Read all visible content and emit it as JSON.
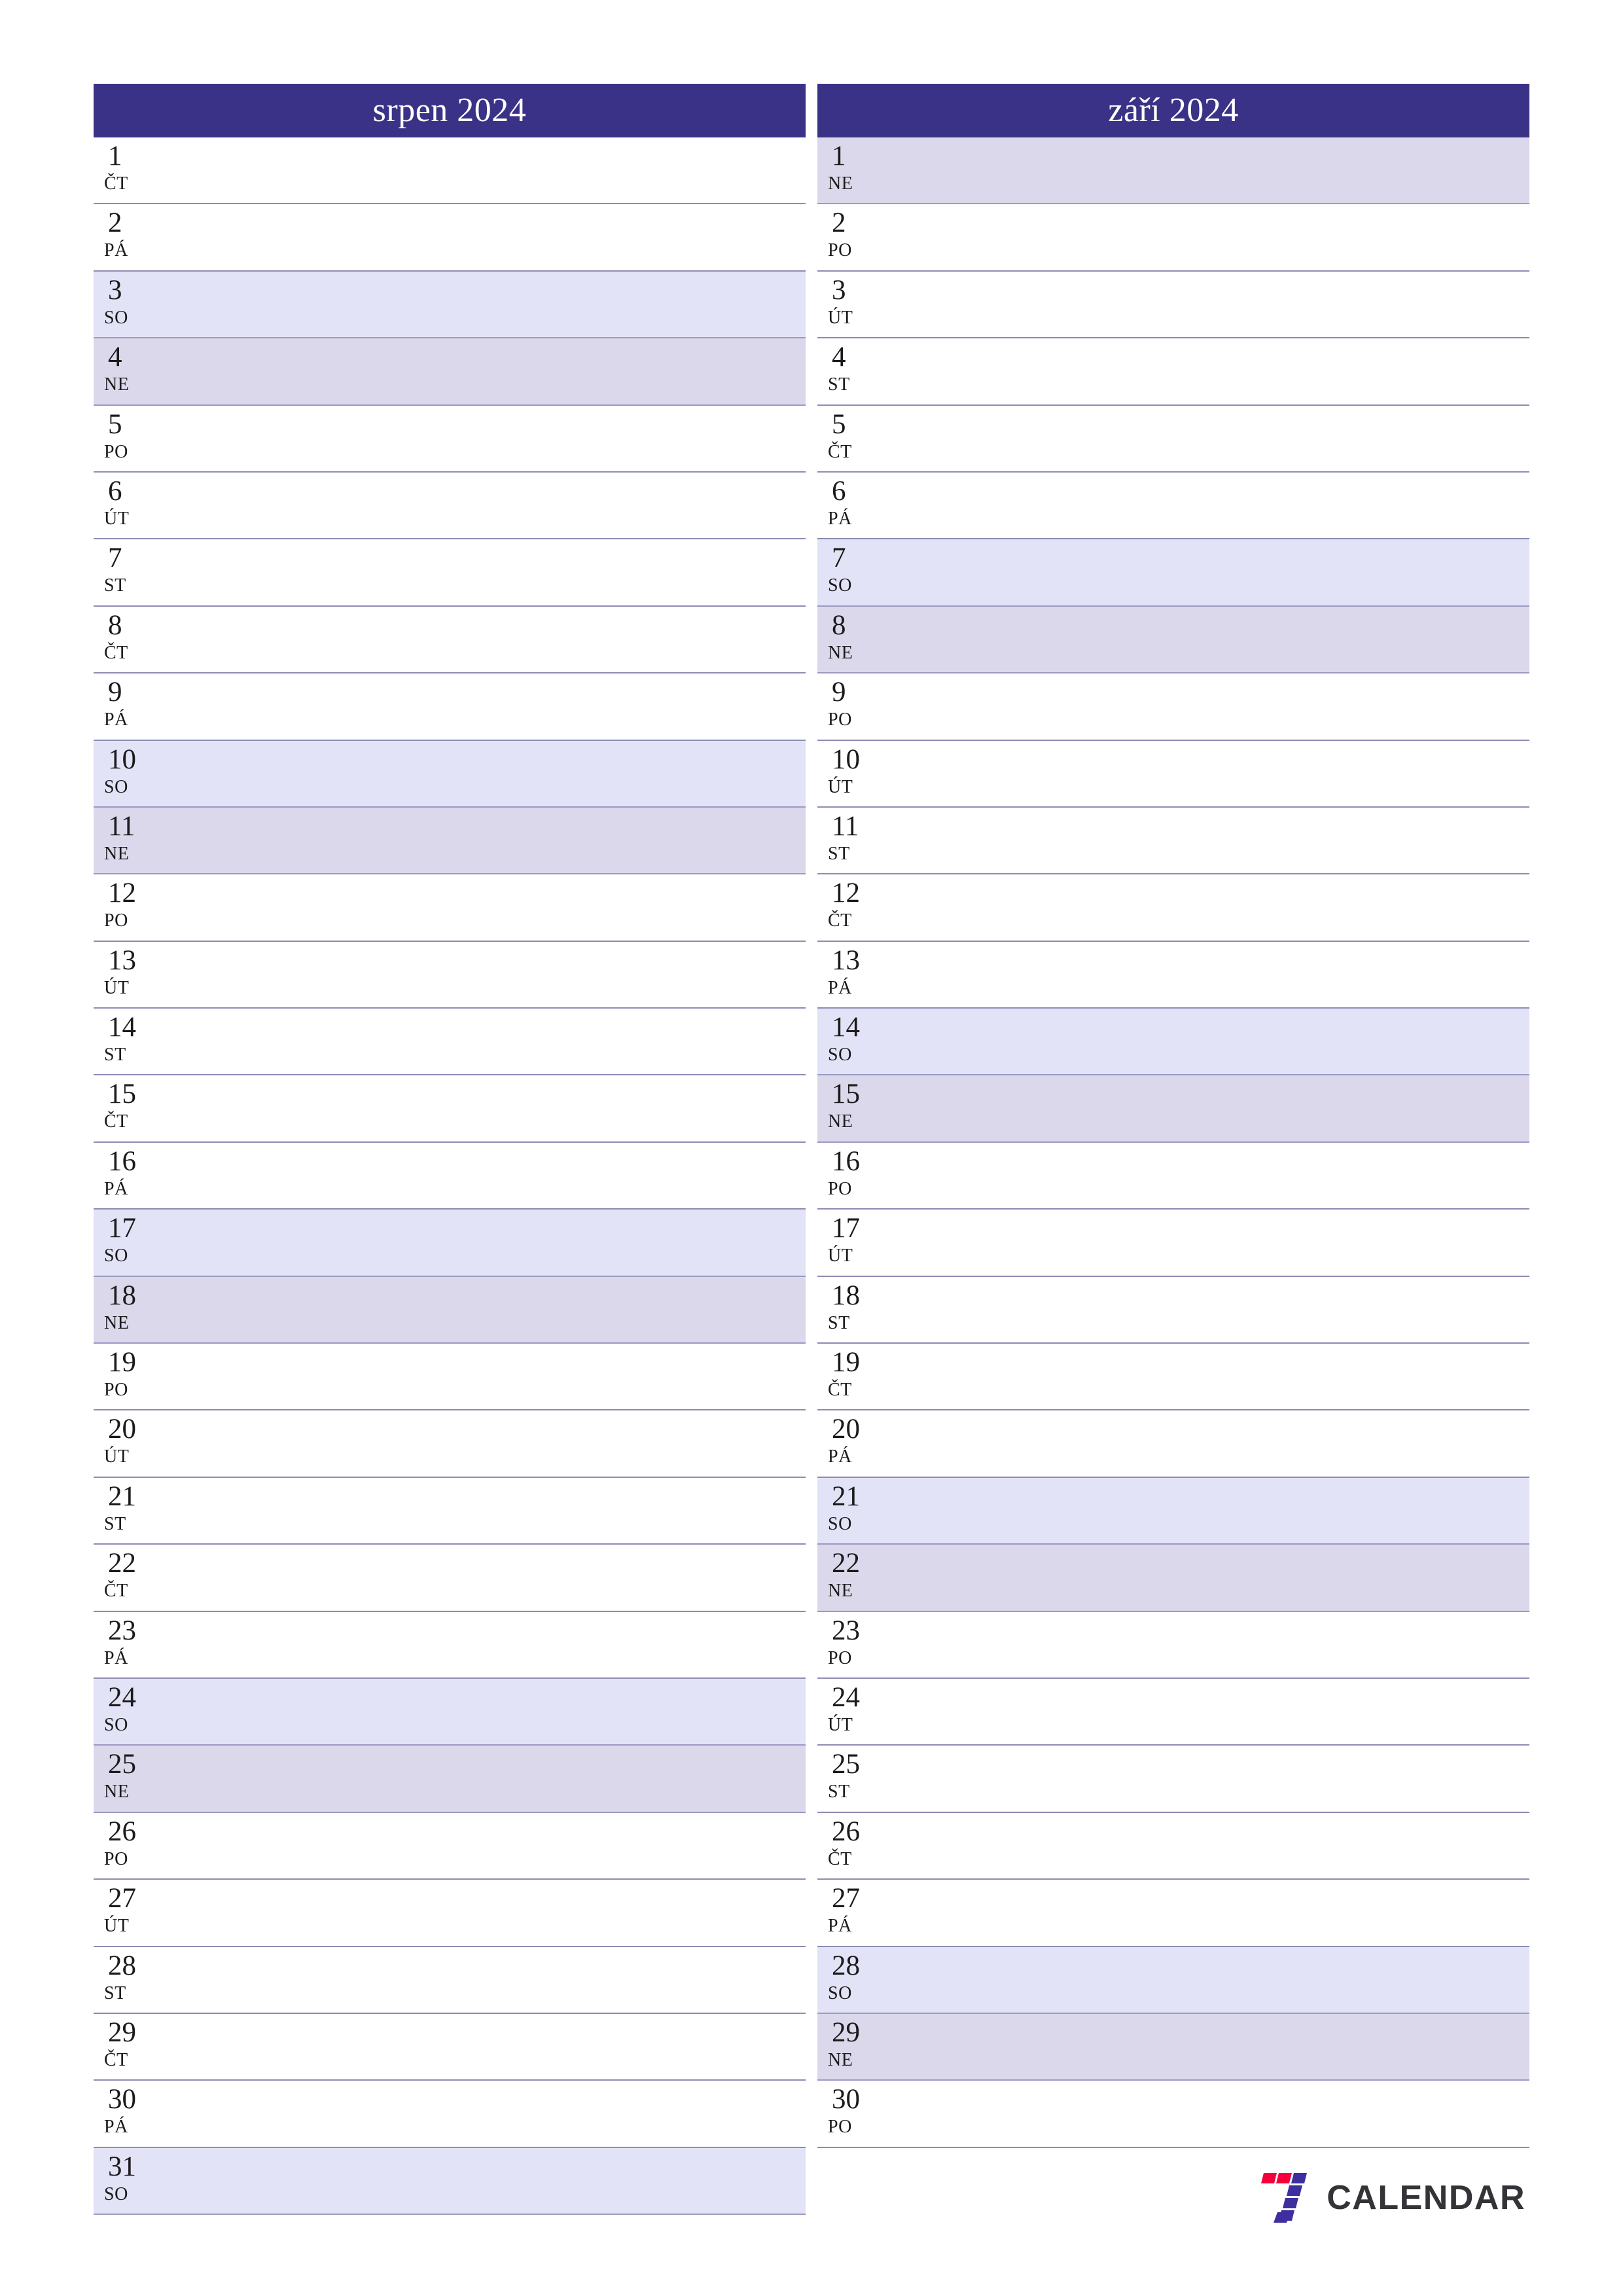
{
  "colors": {
    "header_bg": "#3a3287",
    "saturday_bg": "#e3e3f7",
    "sunday_bg": "#dcd8ec",
    "rule": "#8c8cb4",
    "logo_red": "#f5003c",
    "logo_purple": "#3d2f9e",
    "logo_text": "#333338"
  },
  "months": [
    {
      "title": "srpen 2024",
      "days": [
        {
          "num": "1",
          "dow": "ČT",
          "type": "weekday"
        },
        {
          "num": "2",
          "dow": "PÁ",
          "type": "weekday"
        },
        {
          "num": "3",
          "dow": "SO",
          "type": "sat"
        },
        {
          "num": "4",
          "dow": "NE",
          "type": "sun"
        },
        {
          "num": "5",
          "dow": "PO",
          "type": "weekday"
        },
        {
          "num": "6",
          "dow": "ÚT",
          "type": "weekday"
        },
        {
          "num": "7",
          "dow": "ST",
          "type": "weekday"
        },
        {
          "num": "8",
          "dow": "ČT",
          "type": "weekday"
        },
        {
          "num": "9",
          "dow": "PÁ",
          "type": "weekday"
        },
        {
          "num": "10",
          "dow": "SO",
          "type": "sat"
        },
        {
          "num": "11",
          "dow": "NE",
          "type": "sun"
        },
        {
          "num": "12",
          "dow": "PO",
          "type": "weekday"
        },
        {
          "num": "13",
          "dow": "ÚT",
          "type": "weekday"
        },
        {
          "num": "14",
          "dow": "ST",
          "type": "weekday"
        },
        {
          "num": "15",
          "dow": "ČT",
          "type": "weekday"
        },
        {
          "num": "16",
          "dow": "PÁ",
          "type": "weekday"
        },
        {
          "num": "17",
          "dow": "SO",
          "type": "sat"
        },
        {
          "num": "18",
          "dow": "NE",
          "type": "sun"
        },
        {
          "num": "19",
          "dow": "PO",
          "type": "weekday"
        },
        {
          "num": "20",
          "dow": "ÚT",
          "type": "weekday"
        },
        {
          "num": "21",
          "dow": "ST",
          "type": "weekday"
        },
        {
          "num": "22",
          "dow": "ČT",
          "type": "weekday"
        },
        {
          "num": "23",
          "dow": "PÁ",
          "type": "weekday"
        },
        {
          "num": "24",
          "dow": "SO",
          "type": "sat"
        },
        {
          "num": "25",
          "dow": "NE",
          "type": "sun"
        },
        {
          "num": "26",
          "dow": "PO",
          "type": "weekday"
        },
        {
          "num": "27",
          "dow": "ÚT",
          "type": "weekday"
        },
        {
          "num": "28",
          "dow": "ST",
          "type": "weekday"
        },
        {
          "num": "29",
          "dow": "ČT",
          "type": "weekday"
        },
        {
          "num": "30",
          "dow": "PÁ",
          "type": "weekday"
        },
        {
          "num": "31",
          "dow": "SO",
          "type": "sat"
        }
      ]
    },
    {
      "title": "září 2024",
      "days": [
        {
          "num": "1",
          "dow": "NE",
          "type": "sun"
        },
        {
          "num": "2",
          "dow": "PO",
          "type": "weekday"
        },
        {
          "num": "3",
          "dow": "ÚT",
          "type": "weekday"
        },
        {
          "num": "4",
          "dow": "ST",
          "type": "weekday"
        },
        {
          "num": "5",
          "dow": "ČT",
          "type": "weekday"
        },
        {
          "num": "6",
          "dow": "PÁ",
          "type": "weekday"
        },
        {
          "num": "7",
          "dow": "SO",
          "type": "sat"
        },
        {
          "num": "8",
          "dow": "NE",
          "type": "sun"
        },
        {
          "num": "9",
          "dow": "PO",
          "type": "weekday"
        },
        {
          "num": "10",
          "dow": "ÚT",
          "type": "weekday"
        },
        {
          "num": "11",
          "dow": "ST",
          "type": "weekday"
        },
        {
          "num": "12",
          "dow": "ČT",
          "type": "weekday"
        },
        {
          "num": "13",
          "dow": "PÁ",
          "type": "weekday"
        },
        {
          "num": "14",
          "dow": "SO",
          "type": "sat"
        },
        {
          "num": "15",
          "dow": "NE",
          "type": "sun"
        },
        {
          "num": "16",
          "dow": "PO",
          "type": "weekday"
        },
        {
          "num": "17",
          "dow": "ÚT",
          "type": "weekday"
        },
        {
          "num": "18",
          "dow": "ST",
          "type": "weekday"
        },
        {
          "num": "19",
          "dow": "ČT",
          "type": "weekday"
        },
        {
          "num": "20",
          "dow": "PÁ",
          "type": "weekday"
        },
        {
          "num": "21",
          "dow": "SO",
          "type": "sat"
        },
        {
          "num": "22",
          "dow": "NE",
          "type": "sun"
        },
        {
          "num": "23",
          "dow": "PO",
          "type": "weekday"
        },
        {
          "num": "24",
          "dow": "ÚT",
          "type": "weekday"
        },
        {
          "num": "25",
          "dow": "ST",
          "type": "weekday"
        },
        {
          "num": "26",
          "dow": "ČT",
          "type": "weekday"
        },
        {
          "num": "27",
          "dow": "PÁ",
          "type": "weekday"
        },
        {
          "num": "28",
          "dow": "SO",
          "type": "sat"
        },
        {
          "num": "29",
          "dow": "NE",
          "type": "sun"
        },
        {
          "num": "30",
          "dow": "PO",
          "type": "weekday"
        }
      ]
    }
  ],
  "footer": {
    "logo_text": "CALENDAR",
    "logo_mark_name": "seven-logo-icon"
  }
}
